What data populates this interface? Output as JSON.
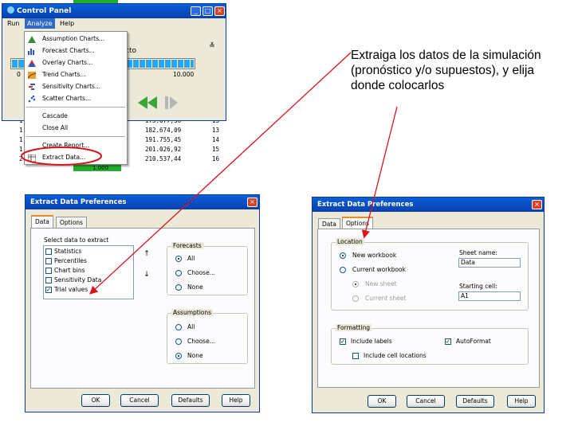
{
  "control_panel": {
    "title": "Control Panel",
    "menubar": [
      "Run",
      "Analyze",
      "Help"
    ],
    "slider_left": "0",
    "slider_right": "10.000",
    "label_fragment": "cto",
    "analyze_menu": [
      "Assumption Charts...",
      "Forecast Charts...",
      "Overlay Charts...",
      "Trend Charts...",
      "Sensitivity Charts...",
      "Scatter Charts...",
      "Cascade",
      "Close All",
      "Create Report...",
      "Extract Data..."
    ]
  },
  "sheet": {
    "rows": [
      {
        "n": "1",
        "a": "173.077,36",
        "b": "13"
      },
      {
        "n": "1",
        "a": "182.674,09",
        "b": "13"
      },
      {
        "n": "1",
        "a": "191.755,45",
        "b": "14"
      },
      {
        "n": "1",
        "a": "201.026,92",
        "b": "15"
      },
      {
        "n": "2",
        "a": "210.537,44",
        "b": "16"
      }
    ],
    "bottom_left": "1.000"
  },
  "dialog_data": {
    "title": "Extract Data Preferences",
    "tabs": [
      "Data",
      "Options"
    ],
    "select_label": "Select data to extract",
    "items": [
      {
        "label": "Statistics",
        "checked": false
      },
      {
        "label": "Percentiles",
        "checked": false
      },
      {
        "label": "Chart bins",
        "checked": false
      },
      {
        "label": "Sensitivity Data",
        "checked": false
      },
      {
        "label": "Trial values",
        "checked": true
      }
    ],
    "forecasts": {
      "title": "Forecasts",
      "options": [
        "All",
        "Choose...",
        "None"
      ],
      "selected": "All"
    },
    "assumptions": {
      "title": "Assumptions",
      "options": [
        "All",
        "Choose...",
        "None"
      ],
      "selected": "None"
    },
    "buttons": [
      "OK",
      "Cancel",
      "Defaults",
      "Help"
    ]
  },
  "dialog_options": {
    "title": "Extract Data Preferences",
    "tabs": [
      "Data",
      "Options"
    ],
    "location_title": "Location",
    "location_options": [
      "New workbook",
      "Current workbook"
    ],
    "sub_options": [
      "New sheet",
      "Current sheet"
    ],
    "sheet_name_label": "Sheet name:",
    "sheet_name_value": "Data",
    "starting_cell_label": "Starting cell:",
    "starting_cell_value": "A1",
    "formatting_title": "Formatting",
    "include_labels": "Include labels",
    "autoformat": "AutoFormat",
    "include_cell_locations": "Include cell locations",
    "buttons": [
      "OK",
      "Cancel",
      "Defaults",
      "Help"
    ]
  },
  "annotation": "Extraiga los datos de la simulación (pronóstico y/o supuestos), y elija donde colocarlos",
  "colors": {
    "annotation_line": "#d8141c",
    "highlight_ellipse": "#d8141c",
    "xp_title": "#0a50c6"
  }
}
